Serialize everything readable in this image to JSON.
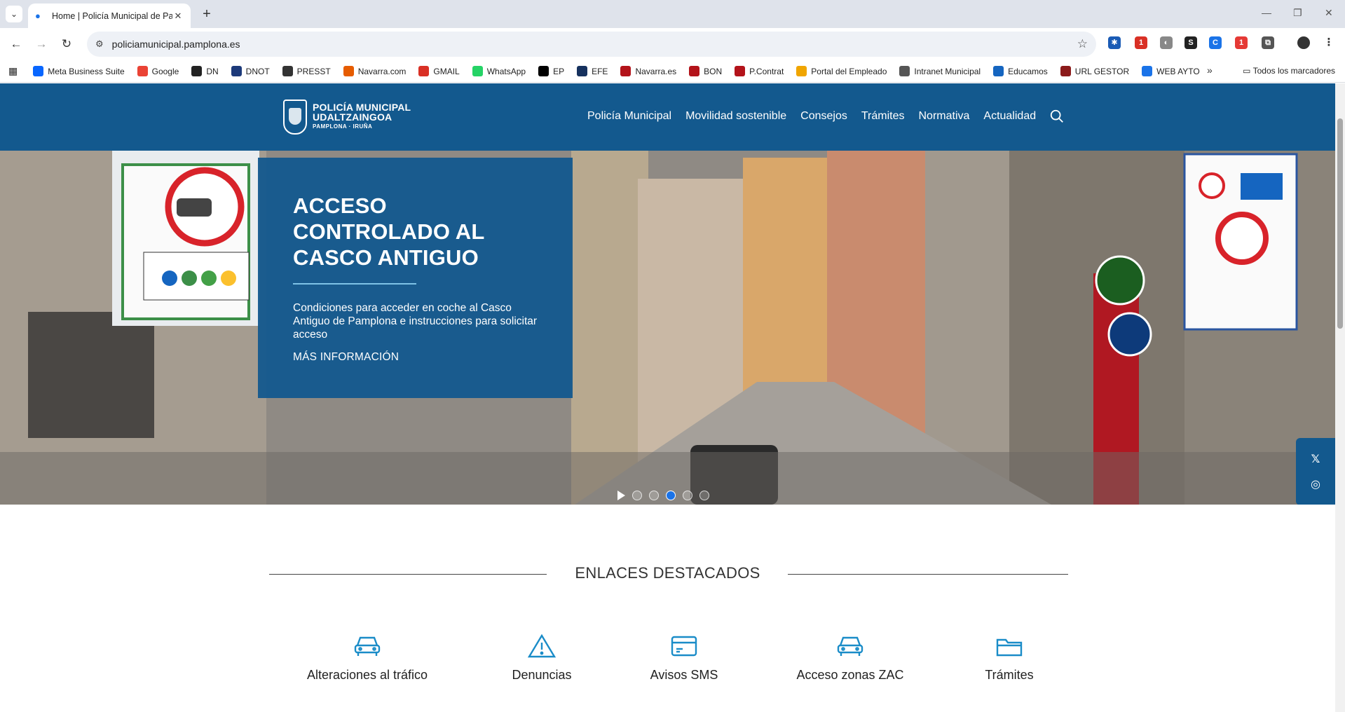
{
  "browser": {
    "tab_title": "Home | Policía Municipal de Pa",
    "url": "policiamunicipal.pamplona.es",
    "bookmarks": [
      {
        "label": "Meta Business Suite",
        "icon": "meta-icon",
        "color": "#0866ff"
      },
      {
        "label": "Google",
        "icon": "google-icon",
        "color": "#ea4335"
      },
      {
        "label": "DN",
        "icon": "dn-icon",
        "color": "#222222"
      },
      {
        "label": "DNOT",
        "icon": "dnot-icon",
        "color": "#1d3a7a"
      },
      {
        "label": "PRESST",
        "icon": "presst-icon",
        "color": "#333333"
      },
      {
        "label": "Navarra.com",
        "icon": "navarra-com-icon",
        "color": "#e65c00"
      },
      {
        "label": "GMAIL",
        "icon": "gmail-icon",
        "color": "#d93025"
      },
      {
        "label": "WhatsApp",
        "icon": "whatsapp-icon",
        "color": "#25d366"
      },
      {
        "label": "EP",
        "icon": "ep-icon",
        "color": "#000000"
      },
      {
        "label": "EFE",
        "icon": "efe-icon",
        "color": "#16315e"
      },
      {
        "label": "Navarra.es",
        "icon": "navarra-es-icon",
        "color": "#b3131a"
      },
      {
        "label": "BON",
        "icon": "bon-icon",
        "color": "#b3131a"
      },
      {
        "label": "P.Contrat",
        "icon": "pcontrat-icon",
        "color": "#b3131a"
      },
      {
        "label": "Portal del Empleado",
        "icon": "portal-empleado-icon",
        "color": "#f0a500"
      },
      {
        "label": "Intranet Municipal",
        "icon": "intranet-icon",
        "color": "#555555"
      },
      {
        "label": "Educamos",
        "icon": "educamos-icon",
        "color": "#1565c0"
      },
      {
        "label": "URL GESTOR",
        "icon": "url-gestor-icon",
        "color": "#8b1a1a"
      },
      {
        "label": "WEB AYTO",
        "icon": "web-ayto-icon",
        "color": "#1a73e8"
      }
    ],
    "all_bookmarks": "Todos los marcadores"
  },
  "site": {
    "logo_line1": "POLICÍA MUNICIPAL",
    "logo_line2": "UDALTZAINGOA",
    "logo_line3": "PAMPLONA · IRUÑA",
    "nav": [
      "Policía Municipal",
      "Movilidad sostenible",
      "Consejos",
      "Trámites",
      "Normativa",
      "Actualidad"
    ]
  },
  "hero": {
    "title": "ACCESO CONTROLADO AL CASCO ANTIGUO",
    "description": "Condiciones para acceder en coche al Casco Antiguo de Pamplona e instrucciones para solicitar acceso",
    "more": "MÁS INFORMACIÓN",
    "slides": 5,
    "active_slide": 3
  },
  "featured": {
    "title": "ENLACES DESTACADOS",
    "items": [
      {
        "label": "Alteraciones al tráfico",
        "icon": "car-icon"
      },
      {
        "label": "Denuncias",
        "icon": "warning-icon"
      },
      {
        "label": "Avisos SMS",
        "icon": "card-icon"
      },
      {
        "label": "Acceso zonas ZAC",
        "icon": "car-icon"
      },
      {
        "label": "Trámites",
        "icon": "folder-icon"
      }
    ]
  },
  "colors": {
    "brand": "#13598e",
    "accent": "#1a8cc8"
  }
}
